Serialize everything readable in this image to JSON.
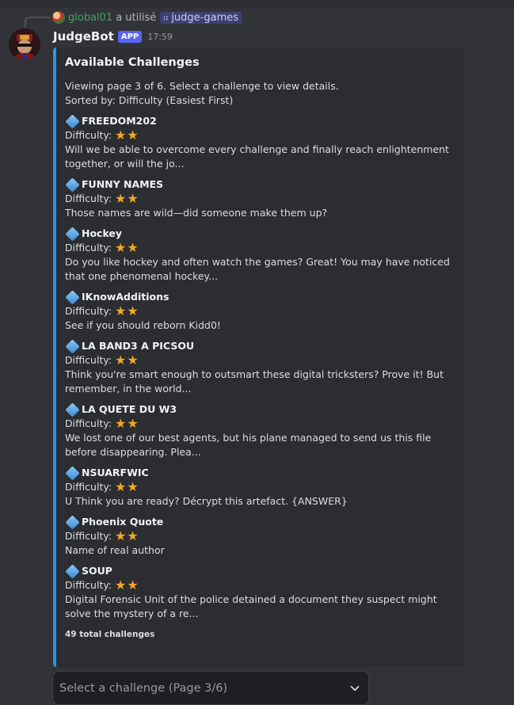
{
  "reply": {
    "user": "global01",
    "action": "a utilisé",
    "command": "judge-games"
  },
  "message": {
    "bot_name": "JudgeBot",
    "badge": "APP",
    "time": "17:59"
  },
  "embed": {
    "title": "Available Challenges",
    "intro_line1": "Viewing page 3 of 6. Select a challenge to view details.",
    "intro_line2": "Sorted by: Difficulty (Easiest First)",
    "difficulty_label": "Difficulty:",
    "challenges": [
      {
        "name": "FREEDOM202",
        "stars": "★★",
        "description": "Will we be able to overcome every challenge and finally reach enlightenment together, or will the jo..."
      },
      {
        "name": "FUNNY NAMES",
        "stars": "★★",
        "description": "Those names are wild—did someone make them up?"
      },
      {
        "name": "Hockey",
        "stars": "★★",
        "description": "Do you like hockey and often watch the games? Great! You may have noticed that one phenomenal hockey..."
      },
      {
        "name": "IKnowAdditions",
        "stars": "★★",
        "description": "See if you should reborn Kidd0!"
      },
      {
        "name": "LA BAND3 A PICSOU",
        "stars": "★★",
        "description": "Think you're smart enough to outsmart these digital tricksters? Prove it! But remember, in the world..."
      },
      {
        "name": "LA QUETE DU W3",
        "stars": "★★",
        "description": "We lost one of our best agents, but his plane managed to send us this file before disappearing. Plea..."
      },
      {
        "name": "NSUARFWIC",
        "stars": "★★",
        "description": "U Think you are ready? Décrypt this artefact. {ANSWER}"
      },
      {
        "name": "Phoenix Quote",
        "stars": "★★",
        "description": "Name of real author"
      },
      {
        "name": "SOUP",
        "stars": "★★",
        "description": "Digital Forensic Unit of the police detained a document they suspect might solve the mystery of a re..."
      }
    ],
    "footer": "49 total challenges"
  },
  "select": {
    "placeholder": "Select a challenge (Page 3/6)"
  },
  "colors": {
    "background": "#323339",
    "embed_bg": "#2b2d31",
    "embed_accent": "#1e9bf0",
    "star": "#f4a62a",
    "app_badge": "#5865f2"
  }
}
